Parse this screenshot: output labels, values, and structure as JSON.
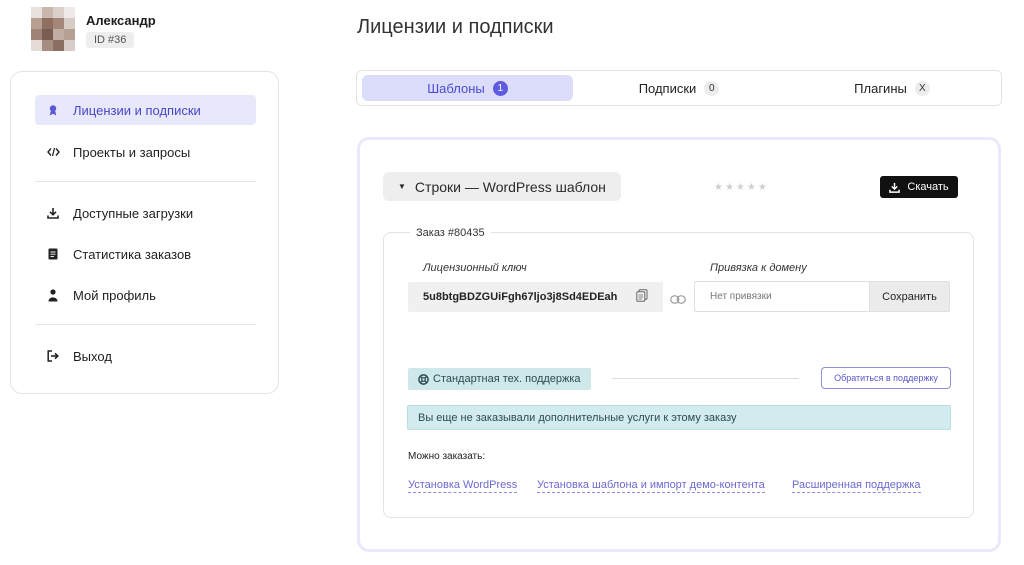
{
  "user": {
    "name": "Александр",
    "id_label": "ID #36"
  },
  "sidebar": {
    "items": [
      {
        "label": "Лицензии и подписки",
        "icon": "license-icon",
        "active": true
      },
      {
        "label": "Проекты и запросы",
        "icon": "code-icon"
      },
      {
        "label": "Доступные загрузки",
        "icon": "download-icon"
      },
      {
        "label": "Статистика заказов",
        "icon": "document-icon"
      },
      {
        "label": "Мой профиль",
        "icon": "user-icon"
      },
      {
        "label": "Выход",
        "icon": "logout-icon"
      }
    ]
  },
  "page": {
    "title": "Лицензии и подписки"
  },
  "tabs": [
    {
      "label": "Шаблоны",
      "count": "1",
      "active": true
    },
    {
      "label": "Подписки",
      "count": "0"
    },
    {
      "label": "Плагины",
      "count": "X"
    }
  ],
  "product": {
    "name": "Строки — WordPress шаблон",
    "rating": "★★★★★",
    "download_label": "Скачать",
    "order_label": "Заказ #80435",
    "license_key_label": "Лицензионный ключ",
    "license_key": "5u8btgBDZGUiFgh67ljo3j8Sd4EDEah",
    "domain_label": "Привязка к домену",
    "domain_placeholder": "Нет привязки",
    "save_label": "Сохранить",
    "support_label": "Стандартная тех. поддержка",
    "contact_label": "Обратиться в поддержку",
    "info_text": "Вы еще не заказывали дополнительные услуги к этому заказу",
    "can_order_label": "Можно заказать:",
    "services": [
      "Установка WordPress",
      "Установка шаблона и импорт демо-контента",
      "Расширенная поддержка"
    ]
  },
  "colors": {
    "accent": "#5e5be0",
    "active_bg": "#e8e8fb",
    "support_bg": "#cfe9ea",
    "info_bg": "#d2ebef"
  }
}
